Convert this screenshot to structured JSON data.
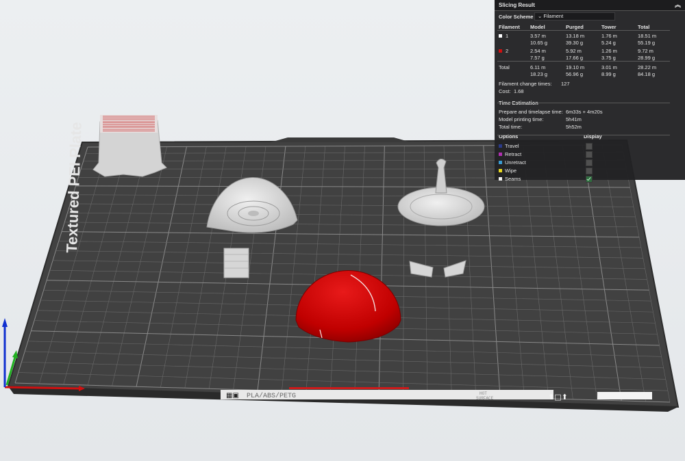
{
  "slicing_result": {
    "title": "Slicing Result",
    "collapse_icon": "chevron-up-double-icon",
    "color_scheme": {
      "label": "Color Scheme",
      "selected": "Filament"
    },
    "table": {
      "headers": [
        "Filament",
        "Model",
        "Purged",
        "Tower",
        "Total"
      ],
      "rows": [
        {
          "id": "1",
          "color": "#ffffff",
          "model": [
            "3.57 m",
            "10.65 g"
          ],
          "purged": [
            "13.18 m",
            "39.30 g"
          ],
          "tower": [
            "1.76 m",
            "5.24 g"
          ],
          "total": [
            "18.51 m",
            "55.19 g"
          ]
        },
        {
          "id": "2",
          "color": "#d01010",
          "model": [
            "2.54 m",
            "7.57 g"
          ],
          "purged": [
            "5.92 m",
            "17.66 g"
          ],
          "tower": [
            "1.26 m",
            "3.75 g"
          ],
          "total": [
            "9.72 m",
            "28.99 g"
          ]
        }
      ],
      "totals": {
        "label": "Total",
        "model": [
          "6.11 m",
          "18.23 g"
        ],
        "purged": [
          "19.10 m",
          "56.96 g"
        ],
        "tower": [
          "3.01 m",
          "8.99 g"
        ],
        "total": [
          "28.22 m",
          "84.18 g"
        ]
      }
    },
    "filament_change": {
      "label": "Filament change times:",
      "value": "127"
    },
    "cost": {
      "label": "Cost:",
      "value": "1.68"
    },
    "time_estimation": {
      "title": "Time Estimation",
      "prepare_label": "Prepare and timelapse time:",
      "prepare_value": "6m33s + 4m20s",
      "model_label": "Model printing time:",
      "model_value": "5h41m",
      "total_label": "Total time:",
      "total_value": "5h52m"
    },
    "options": {
      "header": "Options",
      "display_header": "Display",
      "items": [
        {
          "label": "Travel",
          "color": "#2a3a8a",
          "checked": false
        },
        {
          "label": "Retract",
          "color": "#b030b0",
          "checked": false
        },
        {
          "label": "Unretract",
          "color": "#3a9ad0",
          "checked": false
        },
        {
          "label": "Wipe",
          "color": "#e8d820",
          "checked": false
        },
        {
          "label": "Seams",
          "color": "#f0f0f0",
          "checked": true
        }
      ]
    }
  },
  "plate": {
    "label": "Textured PEI Plate",
    "material_label": "PLA/ABS/PETG",
    "hot_surface_line1": "HOT",
    "hot_surface_line2": "SURFACE"
  },
  "colors": {
    "bed": "#4a4a4a",
    "bed_edge": "#2e2e2e",
    "red_part": "#cc0000",
    "white_part": "#d8d8d8"
  }
}
